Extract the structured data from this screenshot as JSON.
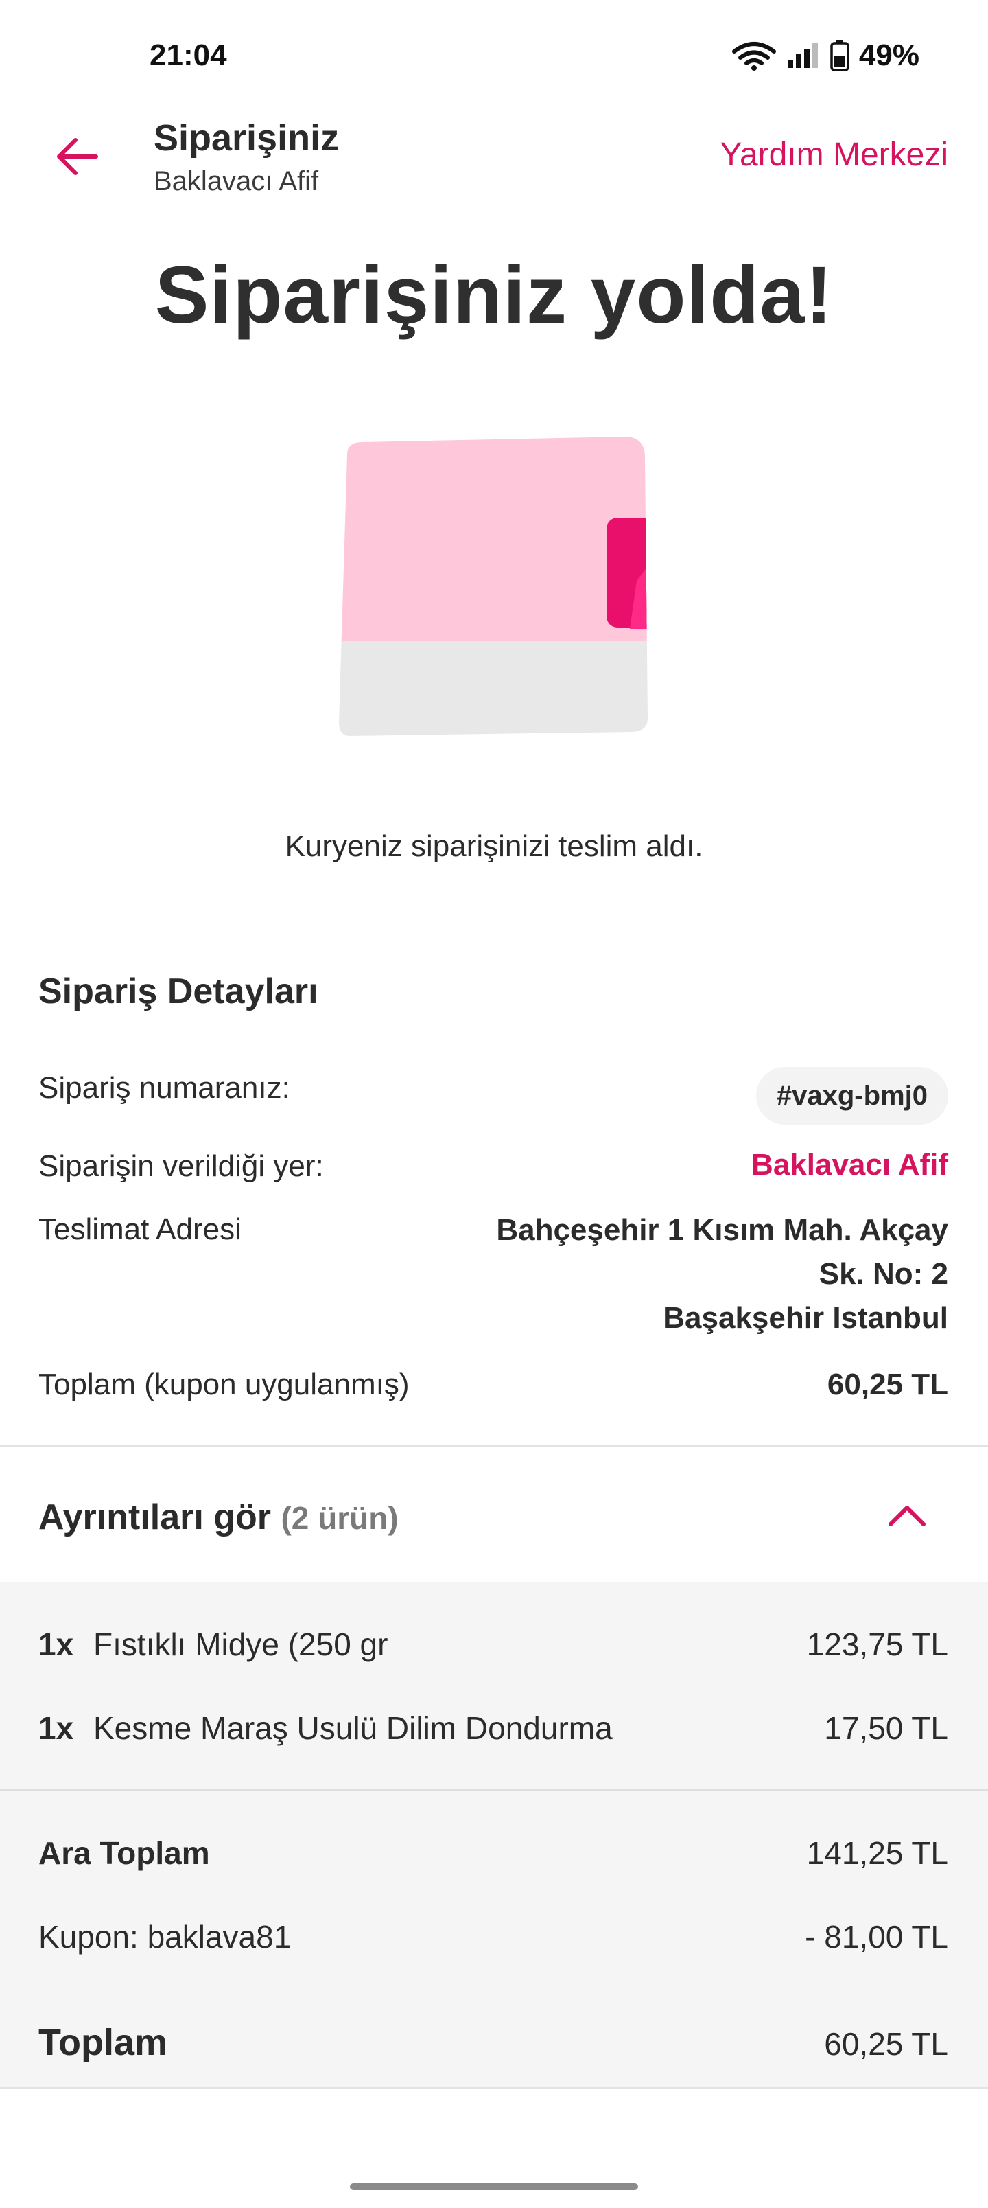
{
  "status_bar": {
    "time": "21:04",
    "battery_percent": "49%",
    "icons": [
      "wifi-icon",
      "signal-icon",
      "battery-icon"
    ]
  },
  "header": {
    "title": "Siparişiniz",
    "subtitle": "Baklavacı Afif",
    "help_link": "Yardım Merkezi",
    "back_icon": "arrow-left-icon"
  },
  "hero": {
    "title": "Siparişiniz yolda!",
    "message": "Kuryeniz siparişinizi teslim aldı."
  },
  "details": {
    "section_title": "Sipariş Detayları",
    "order_number_label": "Sipariş numaranız:",
    "order_number": "#vaxg-bmj0",
    "placed_at_label": "Siparişin verildiği yer:",
    "placed_at": "Baklavacı Afif",
    "address_label": "Teslimat Adresi",
    "address_lines": [
      "Bahçeşehir 1 Kısım Mah. Akçay",
      "Sk. No: 2",
      "Başakşehir Istanbul"
    ],
    "total_label": "Toplam (kupon uygulanmış)",
    "total": "60,25 TL"
  },
  "items_section": {
    "title": "Ayrıntıları gör",
    "count": "(2 ürün)",
    "items": [
      {
        "qty": "1x",
        "name": "Fıstıklı Midye (250 gr",
        "price": "123,75 TL"
      },
      {
        "qty": "1x",
        "name": "Kesme Maraş Usulü Dilim Dondurma",
        "price": "17,50 TL"
      }
    ],
    "subtotal_label": "Ara Toplam",
    "subtotal": "141,25 TL",
    "coupon_label": "Kupon: baklava81",
    "coupon_value": "- 81,00 TL",
    "total_label": "Toplam",
    "total": "60,25 TL"
  },
  "colors": {
    "accent": "#d6135e",
    "text": "#2b2b2b",
    "panel_bg": "#f5f5f5",
    "illustration_pink": "#ffc8da",
    "illustration_gray": "#e8e8e8"
  }
}
